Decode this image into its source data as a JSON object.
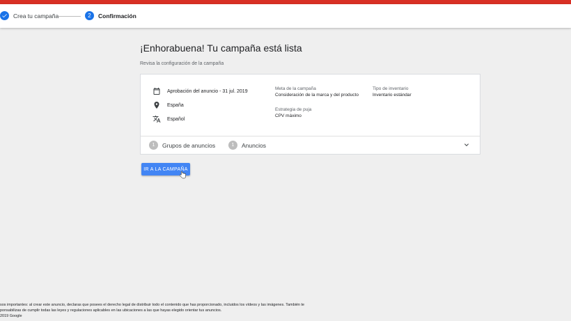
{
  "stepper": {
    "step1_label": "Crea tu campaña",
    "step2_number": "2",
    "step2_label": "Confirmación"
  },
  "main": {
    "title": "¡Enhorabuena! Tu campaña está lista",
    "subtitle": "Revisa la configuración de la campaña"
  },
  "summary": {
    "dates": "Aprobación del anuncio - 31 jul. 2019",
    "location": "España",
    "language": "Español",
    "goal_label": "Meta de la campaña",
    "goal_value": "Consideración de la marca y del producto",
    "bid_label": "Estrategia de puja",
    "bid_value": "CPV máximo",
    "inventory_label": "Tipo de inventario",
    "inventory_value": "Inventario estándar"
  },
  "groups": {
    "ad_groups_count": "1",
    "ad_groups_label": "Grupos de anuncios",
    "ads_count": "1",
    "ads_label": "Anuncios"
  },
  "cta": {
    "label": "IR A LA CAMPAÑA"
  },
  "footer": {
    "line1": "sos importantes: al crear este anuncio, declaras que posees el derecho legal de distribuir todo el contenido que has proporcionado, incluidos los vídeos y las imágenes. También te",
    "line2": "ponsabilizas de cumplir todas las leyes y regulaciones aplicables en las ubicaciones a las que hayas elegido orientar tus anuncios.",
    "line3": "2019 Google"
  },
  "colors": {
    "accent": "#1a73e8",
    "brand_bar": "#d93025",
    "button": "#4285f4"
  }
}
